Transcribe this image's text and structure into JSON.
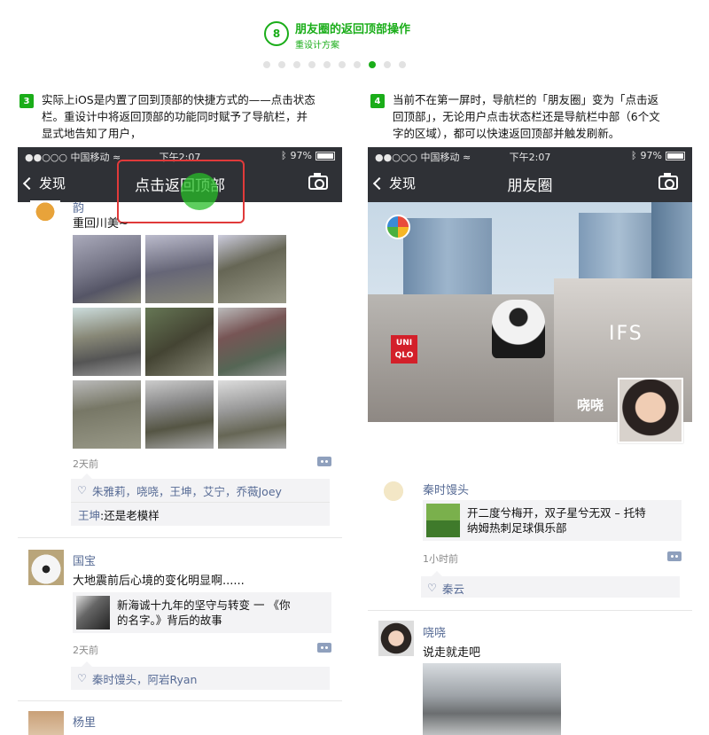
{
  "header": {
    "step_number": "8",
    "title": "朋友圈的返回顶部操作",
    "subtitle": "重设计方案",
    "dots_total": 10,
    "active_dot": 8
  },
  "left": {
    "step_number": "3",
    "description_lines": [
      "实际上iOS是内置了回到顶部的快捷方式的——点击状态",
      "栏。重设计中将返回顶部的功能同时赋予了导航栏，并",
      "显式地告知了用户，"
    ],
    "status": {
      "carrier": "●●○○○ 中国移动",
      "wifi": "wifi-icon",
      "time": "下午2:07",
      "bt": "bluetooth-icon",
      "battery": "97%"
    },
    "nav": {
      "back": "发现",
      "title": "点击返回顶部",
      "camera": "camera-icon"
    },
    "post1": {
      "name": "韵",
      "text": "重回川美~",
      "time": "2天前",
      "likes": "朱雅莉，哓哓，王坤，艾宁，乔薇Joey",
      "comment_name": "王坤",
      "comment_text": ":还是老模样"
    },
    "post2": {
      "name": "国宝",
      "text": "大地震前后心境的变化明显啊......",
      "share_text_1": "新海诚十九年的坚守与转变 一 《你",
      "share_text_2": "的名字。》背后的故事",
      "time": "2天前",
      "likes": "秦时馒头，阿岩Ryan"
    },
    "post3": {
      "name": "杨里"
    }
  },
  "right": {
    "step_number": "4",
    "description_lines": [
      "当前不在第一屏时，导航栏的「朋友圈」变为「点击返",
      "回顶部」，无论用户点击状态栏还是导航栏中部（6个文",
      "字的区域），都可以快速返回顶部并触发刷新。"
    ],
    "status": {
      "carrier": "●●○○○ 中国移动",
      "wifi": "wifi-icon",
      "time": "下午2:07",
      "bt": "bluetooth-icon",
      "battery": "97%"
    },
    "nav": {
      "back": "发现",
      "title": "朋友圈",
      "camera": "camera-icon"
    },
    "cover": {
      "sign_1": "UNI",
      "sign_2": "QLO",
      "sign_3": "IFS",
      "user_name": "哓哓"
    },
    "post1": {
      "name": "秦时馒头",
      "share_text_1": "开二度兮梅开，双子星兮无双 – 托特",
      "share_text_2": "纳姆热刺足球俱乐部",
      "time": "1小时前",
      "likes": "秦云"
    },
    "post2": {
      "name": "哓哓",
      "text": "说走就走吧"
    }
  },
  "colors": {
    "accent": "#1aad19",
    "link": "#576b95",
    "navbar": "#2f3136",
    "highlight": "#e03a3a"
  }
}
